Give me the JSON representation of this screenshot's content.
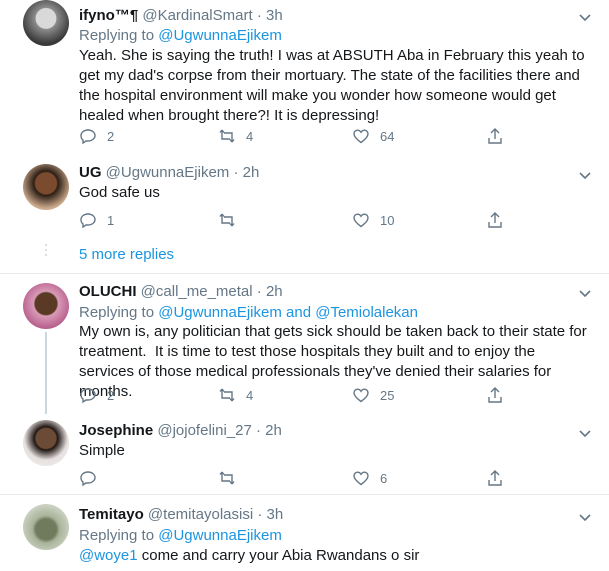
{
  "tweets": [
    {
      "name": "ifyno™¶",
      "handle": "@KardinalSmart",
      "time": "3h",
      "replying_prefix": "Replying to ",
      "replying_to": "@UgwunnaEjikem",
      "text": "Yeah. She is saying the truth! I was at ABSUTH Aba in February this yeah to get my dad's corpse from their mortuary. The state of the facilities there and the hospital environment will make you wonder how someone would get healed when brought there?! It is depressing!",
      "replies": "2",
      "retweets": "4",
      "likes": "64"
    },
    {
      "name": "UG",
      "handle": "@UgwunnaEjikem",
      "time": "2h",
      "text": "God safe us",
      "replies": "1",
      "retweets": "",
      "likes": "10"
    },
    {
      "name": "OLUCHI",
      "handle": "@call_me_metal",
      "time": "2h",
      "replying_prefix": "Replying to ",
      "replying_to": "@UgwunnaEjikem",
      "replying_and": " and ",
      "replying_to2": "@Temiolalekan",
      "text": "My own is, any politician that gets sick should be taken back to their state for treatment.  It is time to test those hospitals they built and to enjoy the services of those medical professionals they've denied their salaries for months.",
      "replies": "2",
      "retweets": "4",
      "likes": "25"
    },
    {
      "name": "Josephine",
      "handle": "@jojofelini_27",
      "time": "2h",
      "text": "Simple",
      "replies": "",
      "retweets": "",
      "likes": "6"
    },
    {
      "name": "Temitayo",
      "handle": "@temitayolasisi",
      "time": "3h",
      "replying_prefix": "Replying to ",
      "replying_to": "@UgwunnaEjikem",
      "mention": "@woye1",
      "text": " come and carry your Abia Rwandans o sir"
    }
  ],
  "more_replies": "5 more replies",
  "separator": "·",
  "colors": {
    "accent": "#1b95e0",
    "muted": "#657786",
    "border": "#e6ecf0"
  },
  "icons": [
    "reply-icon",
    "retweet-icon",
    "like-icon",
    "share-icon",
    "chevron-down-icon"
  ]
}
